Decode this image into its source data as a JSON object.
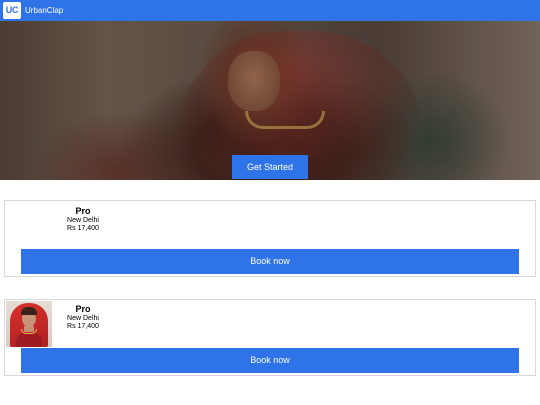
{
  "navbar": {
    "logo_text": "UC",
    "brand": "UrbanClap"
  },
  "hero": {
    "cta_label": "Get Started"
  },
  "listings": [
    {
      "title": "Pro",
      "location": "New Delhi",
      "price": "Rs 17,400",
      "book_label": "Book now",
      "has_image": false
    },
    {
      "title": "Pro",
      "location": "New Delhi",
      "price": "Rs 17,400",
      "book_label": "Book now",
      "has_image": true
    }
  ],
  "colors": {
    "accent": "#2f73e8"
  }
}
